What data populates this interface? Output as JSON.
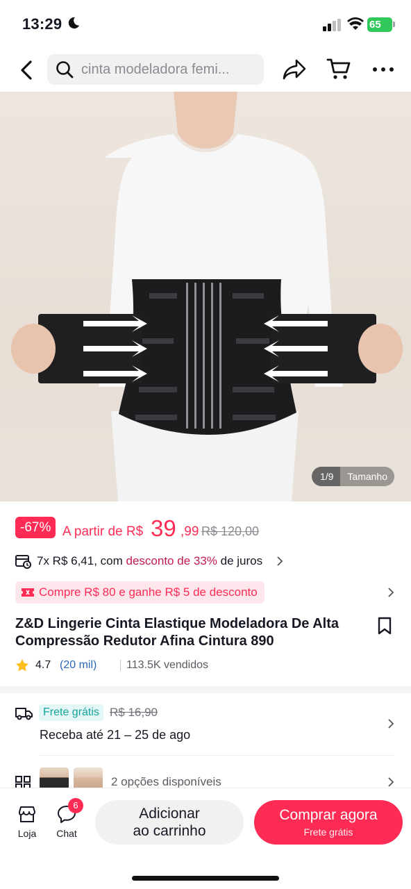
{
  "status_bar": {
    "time": "13:29",
    "battery": "65"
  },
  "header": {
    "search_placeholder": "cinta modeladora femi..."
  },
  "gallery": {
    "index": "1/9",
    "tab": "Tamanho"
  },
  "price": {
    "discount": "-67%",
    "from_label": "A partir de R$",
    "integer": "39",
    "cents": ",99",
    "original": "R$ 120,00"
  },
  "installments": {
    "prefix": "7x R$ 6,41, com ",
    "highlight": "desconto de 33%",
    "suffix": " de juros"
  },
  "promo": {
    "text": "Compre R$ 80 e ganhe R$ 5 de desconto"
  },
  "product": {
    "title": "Z&D Lingerie Cinta Elastique Modeladora De Alta Compressão Redutor Afina Cintura 890",
    "rating": "4.7",
    "reviews": "(20 mil)",
    "sold": "113.5K vendidos"
  },
  "shipping": {
    "badge": "Frete grátis",
    "old_price": "R$ 16,90",
    "delivery": "Receba até 21 – 25 de ago"
  },
  "options": {
    "text": "2 opções disponíveis"
  },
  "bottom_bar": {
    "store_label": "Loja",
    "chat_label": "Chat",
    "chat_badge": "6",
    "add_line1": "Adicionar",
    "add_line2": "ao carrinho",
    "buy_line1": "Comprar agora",
    "buy_line2": "Frete grátis"
  },
  "colors": {
    "accent": "#fe2c55",
    "teal": "#16a39c",
    "link": "#2b66b5"
  },
  "icons": [
    "moon-icon",
    "signal-icon",
    "wifi-icon",
    "back-icon",
    "search-icon",
    "share-icon",
    "cart-icon",
    "more-icon",
    "installment-icon",
    "coupon-icon",
    "bookmark-icon",
    "star-icon",
    "truck-icon",
    "grid-icon",
    "store-icon",
    "chat-icon"
  ]
}
